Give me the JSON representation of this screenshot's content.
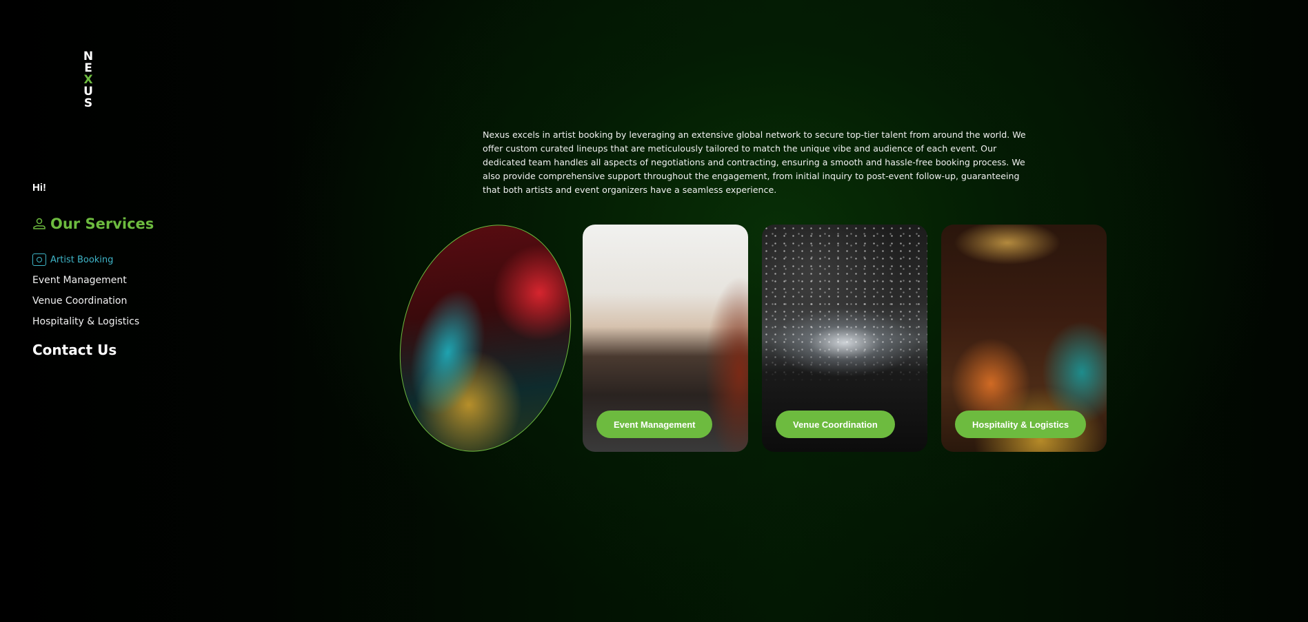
{
  "logo": {
    "letters": [
      "N",
      "E",
      "X",
      "U",
      "S"
    ]
  },
  "sidebar": {
    "greeting": "Hi!",
    "section_title": "Our Services",
    "items": [
      {
        "label": "Artist Booking",
        "active": true
      },
      {
        "label": "Event Management",
        "active": false
      },
      {
        "label": "Venue Coordination",
        "active": false
      },
      {
        "label": "Hospitality & Logistics",
        "active": false
      }
    ],
    "contact": "Contact Us"
  },
  "main": {
    "description": "Nexus excels in artist booking by leveraging an extensive global network to secure top-tier talent from around the world. We offer custom curated lineups that are meticulously tailored to match the unique vibe and audience of each event. Our dedicated team handles all aspects of negotiations and contracting, ensuring a smooth and hassle-free booking process. We also provide comprehensive support throughout the engagement, from initial inquiry to post-event follow-up, guaranteeing that both artists and event organizers have a seamless experience.",
    "cards": [
      {
        "button": ""
      },
      {
        "button": "Event Management"
      },
      {
        "button": "Venue Coordination"
      },
      {
        "button": "Hospitality & Logistics"
      }
    ]
  },
  "colors": {
    "accent": "#6dbb3f",
    "active_item": "#3fb7c9",
    "background": "#000000"
  }
}
